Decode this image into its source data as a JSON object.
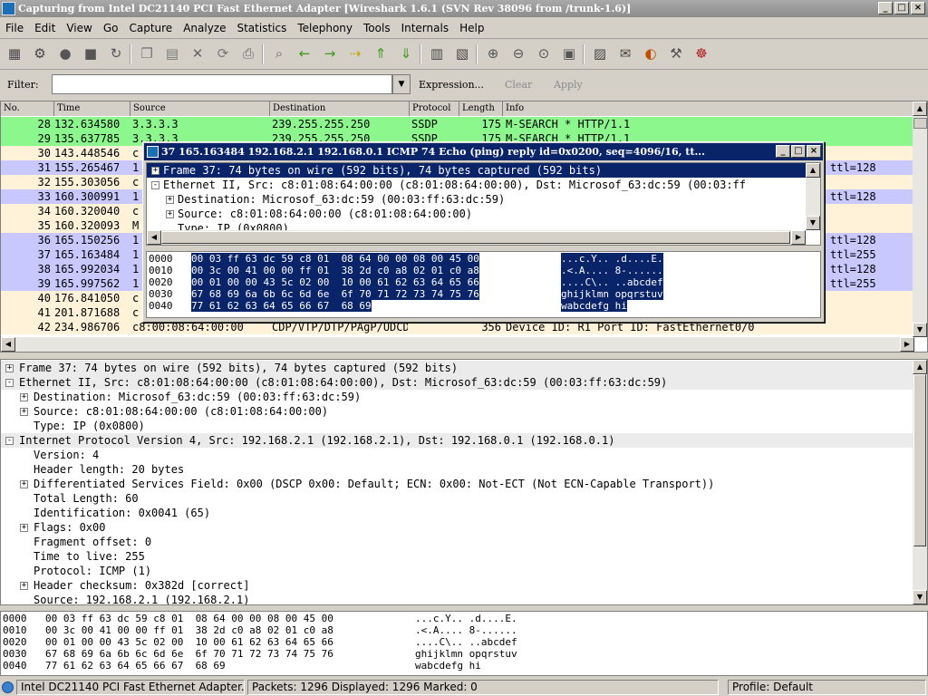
{
  "window": {
    "title": "Capturing from Intel DC21140 PCI Fast Ethernet Adapter    [Wireshark 1.6.1  (SVN Rev 38096 from /trunk-1.6)]",
    "buttons": [
      "_",
      "□",
      "×"
    ]
  },
  "menu": [
    "File",
    "Edit",
    "View",
    "Go",
    "Capture",
    "Analyze",
    "Statistics",
    "Telephony",
    "Tools",
    "Internals",
    "Help"
  ],
  "toolbar_icons": [
    "interface-list-icon",
    "capture-options-icon",
    "start-capture-icon",
    "stop-capture-icon",
    "restart-capture-icon",
    "open-file-icon",
    "save-file-icon",
    "close-file-icon",
    "reload-icon",
    "print-icon",
    "find-packet-icon",
    "go-back-icon",
    "go-forward-icon",
    "go-to-packet-icon",
    "go-first-icon",
    "go-last-icon",
    "colorize-icon",
    "auto-scroll-icon",
    "zoom-in-icon",
    "zoom-out-icon",
    "zoom-normal-icon",
    "resize-columns-icon",
    "capture-filters-icon",
    "display-filters-icon",
    "coloring-rules-icon",
    "preferences-icon",
    "help-icon"
  ],
  "filter": {
    "label": "Filter:",
    "value": "",
    "expression": "Expression...",
    "clear": "Clear",
    "apply": "Apply"
  },
  "packet_list": {
    "columns": [
      "No.",
      "Time",
      "Source",
      "Destination",
      "Protocol",
      "Length",
      "Info"
    ],
    "rows": [
      {
        "no": "28",
        "time": "132.634580",
        "source": "3.3.3.3",
        "destination": "239.255.255.250",
        "protocol": "SSDP",
        "length": "175",
        "info": "M-SEARCH * HTTP/1.1",
        "bg": "#8cf78c"
      },
      {
        "no": "29",
        "time": "135.637785",
        "source": "3.3.3.3",
        "destination": "239.255.255.250",
        "protocol": "SSDP",
        "length": "175",
        "info": "M-SEARCH * HTTP/1.1",
        "bg": "#8cf78c"
      },
      {
        "no": "30",
        "time": "143.448546",
        "source": "c",
        "destination": "",
        "protocol": "",
        "length": "",
        "info": "",
        "bg": "#fff2d9"
      },
      {
        "no": "31",
        "time": "155.265467",
        "source": "1",
        "destination": "",
        "protocol": "",
        "length": "",
        "info": "ttl=128",
        "bg": "#c8c8ff"
      },
      {
        "no": "32",
        "time": "155.303056",
        "source": "c",
        "destination": "",
        "protocol": "",
        "length": "",
        "info": "",
        "bg": "#fff2d9"
      },
      {
        "no": "33",
        "time": "160.300991",
        "source": "1",
        "destination": "",
        "protocol": "",
        "length": "",
        "info": "ttl=128",
        "bg": "#c8c8ff"
      },
      {
        "no": "34",
        "time": "160.320040",
        "source": "c",
        "destination": "",
        "protocol": "",
        "length": "",
        "info": "",
        "bg": "#fff2d9"
      },
      {
        "no": "35",
        "time": "160.320093",
        "source": "M",
        "destination": "",
        "protocol": "",
        "length": "",
        "info": "",
        "bg": "#fff2d9"
      },
      {
        "no": "36",
        "time": "165.150256",
        "source": "1",
        "destination": "",
        "protocol": "",
        "length": "",
        "info": "ttl=128",
        "bg": "#c8c8ff"
      },
      {
        "no": "37",
        "time": "165.163484",
        "source": "1",
        "destination": "",
        "protocol": "",
        "length": "",
        "info": "ttl=255",
        "bg": "#c8c8ff"
      },
      {
        "no": "38",
        "time": "165.992034",
        "source": "1",
        "destination": "",
        "protocol": "",
        "length": "",
        "info": "ttl=128",
        "bg": "#c8c8ff"
      },
      {
        "no": "39",
        "time": "165.997562",
        "source": "1",
        "destination": "",
        "protocol": "",
        "length": "",
        "info": "ttl=255",
        "bg": "#c8c8ff"
      },
      {
        "no": "40",
        "time": "176.841050",
        "source": "c",
        "destination": "",
        "protocol": "",
        "length": "",
        "info": "",
        "bg": "#fff2d9"
      },
      {
        "no": "41",
        "time": "201.871688",
        "source": "c",
        "destination": "",
        "protocol": "",
        "length": "",
        "info": "",
        "bg": "#fff2d9"
      },
      {
        "no": "42",
        "time": "234.986706",
        "source": "c8:00:08:64:00:00",
        "destination": "CDP/VTP/DTP/PAgP/UDCDP",
        "protocol": "",
        "length": "356",
        "info": "Device ID: R1  Port ID: FastEthernet0/0",
        "bg": "#fff2d9"
      }
    ]
  },
  "popup": {
    "title": "37 165.163484 192.168.2.1 192.168.0.1 ICMP 74 Echo (ping) reply    id=0x0200, seq=4096/16, tt...",
    "tree": [
      {
        "text": "Frame 37: 74 bytes on wire (592 bits), 74 bytes captured (592 bits)",
        "indent": 0,
        "exp": "+",
        "selected": true
      },
      {
        "text": "Ethernet II, Src: c8:01:08:64:00:00 (c8:01:08:64:00:00), Dst: Microsof_63:dc:59 (00:03:ff",
        "indent": 0,
        "exp": "-",
        "selected": false
      },
      {
        "text": "Destination: Microsof_63:dc:59 (00:03:ff:63:dc:59)",
        "indent": 1,
        "exp": "+",
        "selected": false
      },
      {
        "text": "Source: c8:01:08:64:00:00 (c8:01:08:64:00:00)",
        "indent": 1,
        "exp": "+",
        "selected": false
      },
      {
        "text": "Type: IP (0x0800)",
        "indent": 1,
        "exp": "",
        "selected": false
      }
    ]
  },
  "hex": [
    {
      "offset": "0000",
      "bytes": "00 03 ff 63 dc 59 c8 01  08 64 00 00 08 00 45 00",
      "ascii": "...c.Y.. .d....E."
    },
    {
      "offset": "0010",
      "bytes": "00 3c 00 41 00 00 ff 01  38 2d c0 a8 02 01 c0 a8",
      "ascii": ".<.A.... 8-......"
    },
    {
      "offset": "0020",
      "bytes": "00 01 00 00 43 5c 02 00  10 00 61 62 63 64 65 66",
      "ascii": "....C\\.. ..abcdef"
    },
    {
      "offset": "0030",
      "bytes": "67 68 69 6a 6b 6c 6d 6e  6f 70 71 72 73 74 75 76",
      "ascii": "ghijklmn opqrstuv"
    },
    {
      "offset": "0040",
      "bytes": "77 61 62 63 64 65 66 67  68 69",
      "ascii": "wabcdefg hi"
    }
  ],
  "detail_tree": [
    {
      "text": "Frame 37: 74 bytes on wire (592 bits), 74 bytes captured (592 bits)",
      "indent": 0,
      "exp": "+",
      "shade": true
    },
    {
      "text": "Ethernet II, Src: c8:01:08:64:00:00 (c8:01:08:64:00:00), Dst: Microsof_63:dc:59 (00:03:ff:63:dc:59)",
      "indent": 0,
      "exp": "-",
      "shade": true
    },
    {
      "text": "Destination: Microsof_63:dc:59 (00:03:ff:63:dc:59)",
      "indent": 1,
      "exp": "+",
      "shade": false
    },
    {
      "text": "Source: c8:01:08:64:00:00 (c8:01:08:64:00:00)",
      "indent": 1,
      "exp": "+",
      "shade": false
    },
    {
      "text": "Type: IP (0x0800)",
      "indent": 1,
      "exp": "",
      "shade": false
    },
    {
      "text": "Internet Protocol Version 4, Src: 192.168.2.1 (192.168.2.1), Dst: 192.168.0.1 (192.168.0.1)",
      "indent": 0,
      "exp": "-",
      "shade": true
    },
    {
      "text": "Version: 4",
      "indent": 1,
      "exp": "",
      "shade": false
    },
    {
      "text": "Header length: 20 bytes",
      "indent": 1,
      "exp": "",
      "shade": false
    },
    {
      "text": "Differentiated Services Field: 0x00 (DSCP 0x00: Default; ECN: 0x00: Not-ECT (Not ECN-Capable Transport))",
      "indent": 1,
      "exp": "+",
      "shade": false
    },
    {
      "text": "Total Length: 60",
      "indent": 1,
      "exp": "",
      "shade": false
    },
    {
      "text": "Identification: 0x0041 (65)",
      "indent": 1,
      "exp": "",
      "shade": false
    },
    {
      "text": "Flags: 0x00",
      "indent": 1,
      "exp": "+",
      "shade": false
    },
    {
      "text": "Fragment offset: 0",
      "indent": 1,
      "exp": "",
      "shade": false
    },
    {
      "text": "Time to live: 255",
      "indent": 1,
      "exp": "",
      "shade": false
    },
    {
      "text": "Protocol: ICMP (1)",
      "indent": 1,
      "exp": "",
      "shade": false
    },
    {
      "text": "Header checksum: 0x382d [correct]",
      "indent": 1,
      "exp": "+",
      "shade": false
    },
    {
      "text": "Source: 192.168.2.1 (192.168.2.1)",
      "indent": 1,
      "exp": "",
      "shade": false
    }
  ],
  "status": {
    "interface": "Intel DC21140 PCI Fast Ethernet Adapter...",
    "packets": "Packets: 1296 Displayed: 1296 Marked: 0",
    "profile": "Profile: Default"
  },
  "colors": {
    "selection": "#0a246a",
    "udp_green": "#8cf78c",
    "icmp_lavender": "#c8c8ff",
    "cdp_beige": "#fff2d9"
  }
}
